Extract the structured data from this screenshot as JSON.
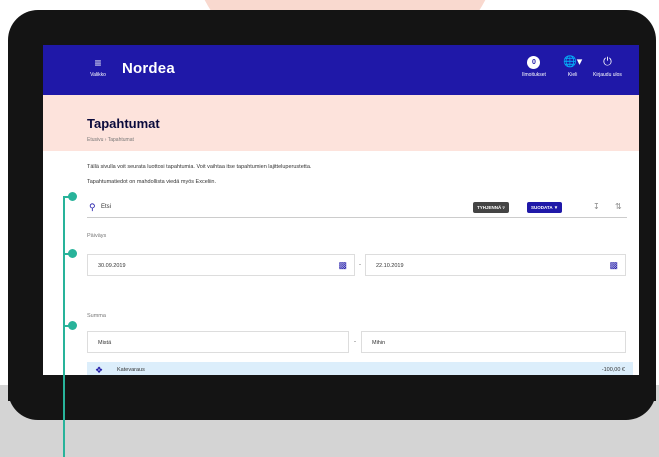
{
  "header": {
    "menu_label": "Valikko",
    "brand": "Nordea",
    "notifications_count": "0",
    "notifications_label": "Ilmoitukset",
    "language_label": "Kieli",
    "logout_label": "Kirjaudu ulos"
  },
  "page": {
    "title": "Tapahtumat",
    "breadcrumb": "Etusivu › Tapahtumat",
    "info_line_1": "Tällä sivulla voit seurata luottosi tapahtumia. Voit vaihtaa itse tapahtumien lajitteluperustetta.",
    "info_line_2": "Tapahtumatiedot on mahdollista viedä myös Exceliin."
  },
  "search": {
    "placeholder": "Etsi",
    "clear_label": "TYHJENNÄ",
    "filter_label": "SUODATA"
  },
  "filters": {
    "date_label": "Päiväys",
    "date_from": "30.09.2019",
    "date_to": "22.10.2019",
    "sum_label": "Summa",
    "sum_from": "Mistä",
    "sum_to": "Mihin",
    "separator": "-"
  },
  "results": [
    {
      "label": "Katevaraus",
      "amount": "-100,00 €"
    }
  ],
  "colors": {
    "brand_blue": "#1f18a8",
    "callout_green": "#28b39a",
    "title_band": "#fde3dc"
  }
}
